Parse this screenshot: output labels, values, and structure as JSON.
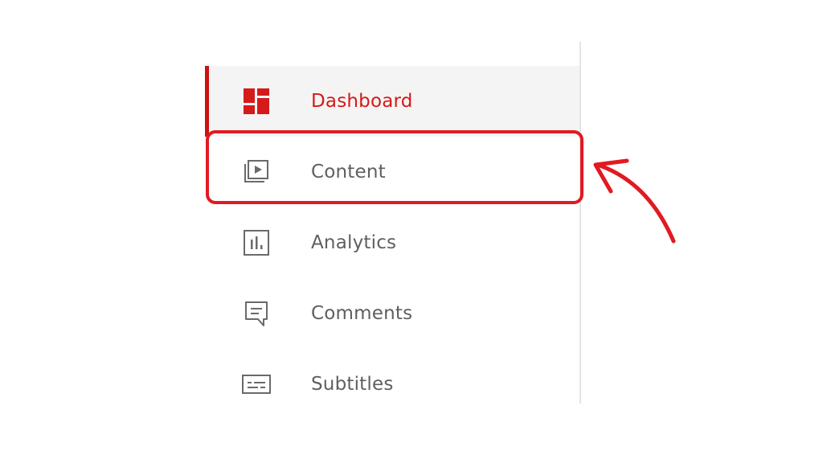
{
  "sidebar": {
    "items": [
      {
        "label": "Dashboard",
        "icon": "dashboard-icon",
        "active": true
      },
      {
        "label": "Content",
        "icon": "content-icon",
        "active": false,
        "highlighted": true
      },
      {
        "label": "Analytics",
        "icon": "analytics-icon",
        "active": false
      },
      {
        "label": "Comments",
        "icon": "comments-icon",
        "active": false
      },
      {
        "label": "Subtitles",
        "icon": "subtitles-icon",
        "active": false
      }
    ]
  },
  "colors": {
    "accent": "#d51a1a",
    "highlight": "#e11a22",
    "text": "#5f5f5f",
    "active_background": "#f4f4f4"
  }
}
